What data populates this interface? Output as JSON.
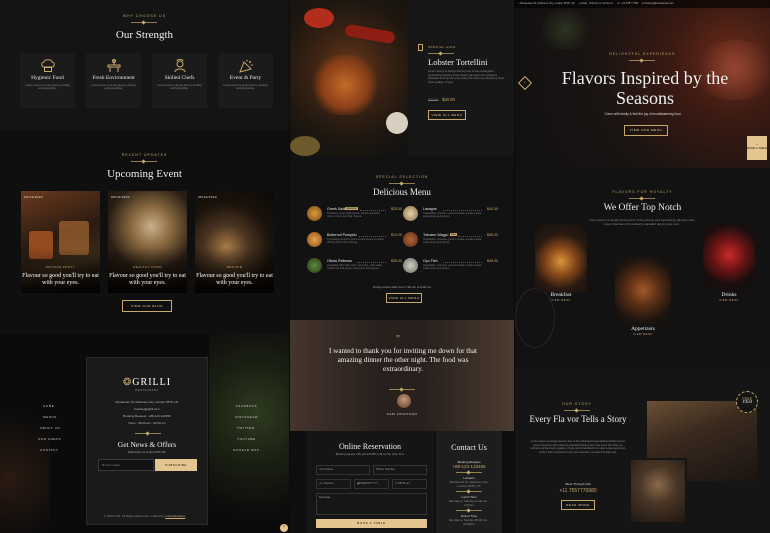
{
  "col1": {
    "strength": {
      "eyebrow": "WHY CHOOSE US",
      "title": "Our Strength",
      "cards": [
        {
          "icon": "chef-hat-icon",
          "title": "Hygienic Food",
          "desc": "Lorem Ipsum is simply dummy printing and typesetting."
        },
        {
          "icon": "restaurant-icon",
          "title": "Fresh Environment",
          "desc": "Lorem Ipsum is simply dummy printing and typesetting."
        },
        {
          "icon": "cook-icon",
          "title": "Skilled Chefs",
          "desc": "Lorem Ipsum is simply dummy printing and typesetting."
        },
        {
          "icon": "celebration-icon",
          "title": "Event & Party",
          "desc": "Lorem Ipsum is simply dummy printing and typesetting."
        }
      ]
    },
    "events": {
      "eyebrow": "RECENT UPDATES",
      "title": "Upcoming Event",
      "cards": [
        {
          "date": "09/12/2022",
          "tag": "PRIVATE PARTY",
          "caption": "Flavour so good you'll try to eat with your eyes."
        },
        {
          "date": "06/12/2022",
          "tag": "HEALTHY FOOD",
          "caption": "Flavour so good you'll try to eat with your eyes."
        },
        {
          "date": "06/12/2022",
          "tag": "RECIPIE",
          "caption": "Flavour so good you'll try to eat with your eyes."
        }
      ],
      "button": "VIEW OUR BLOG"
    },
    "footer": {
      "links_left": [
        "HOME",
        "MENUS",
        "ABOUT US",
        "OUR CHEFS",
        "CONTACT"
      ],
      "links_right": [
        "FACEBOOK",
        "INSTAGRAM",
        "TWITTER",
        "YOUTUBE",
        "GOOGLE MAP"
      ],
      "logo": "GRILLI",
      "logo_sub": "RESTAURANT",
      "address": "Restaurant St, Delicious City, London 9578, UK",
      "email": "booking@grilli.com",
      "booking": "Booking Request : +88-123-123456",
      "hours": "Open : 09:00 am - 01:00 pm",
      "newsletter_title": "Get News & Offers",
      "newsletter_sub": "Subscribe us & Get 25% Off.",
      "email_placeholder": "Your email",
      "subscribe": "SUBSCRIBE",
      "copyright": "© 2022 Grilli. All Rights Reserved | Crafted by",
      "credit": "codewithsadee"
    }
  },
  "col2": {
    "dish": {
      "eyebrow": "SPECIAL DISH",
      "title": "Lobster Tortellini",
      "desc": "Lorem Ipsum is simply dummy text of the printingand typesetting industry lorem Ipsum has been the industrys standard dummy text ever since the when an unknown printer took a galley of type.",
      "old_price": "$40.00",
      "price": "$20.00",
      "button": "VIEW ALL MENU"
    },
    "menu": {
      "eyebrow": "SPECIAL SELECTION",
      "title": "Delicious Menu",
      "items": [
        {
          "name": "Greek Salad",
          "badge": "Seasonal",
          "price": "$25.50",
          "desc": "Tomatoes, green bell pepper, sliced cucumber onion, olives, and feta cheese."
        },
        {
          "name": "Lasagne",
          "badge": "",
          "price": "$40.00",
          "desc": "Vegetables, cheeses, ground meats, tomato sauce, seasonings and spices"
        },
        {
          "name": "Butternut Pumpkin",
          "badge": "",
          "price": "$10.00",
          "desc": "Typesetting industry lorem Lorem Ipsum is simply dummy text of the printing."
        },
        {
          "name": "Tokusen Wagyu",
          "badge": "New",
          "price": "$39.00",
          "desc": "Vegetables, cheeses, ground meats, tomato sauce, seasonings and spices."
        },
        {
          "name": "Olivas Rellenas",
          "badge": "",
          "price": "$25.00",
          "desc": "Avocados with crab meat, red onion, crab salad stuffed red bell pepper and green bell pepper."
        },
        {
          "name": "Opu Fish",
          "badge": "",
          "price": "$49.00",
          "desc": "Vegetables, cheeses, ground meats, tomato sauce, seasonings and spices"
        }
      ],
      "hours_note": "During winter daily from 7:00 pm to 9:00 pm",
      "button": "VIEW ALL MENU"
    },
    "testimonial": {
      "quote": "I wanted to thank you for inviting me down for that amazing dinner the other night. The food was extraordinary.",
      "author": "SAM JONATHAN"
    },
    "reservation": {
      "title": "Online Reservation",
      "subtitle": "Booking request +88-123-123456 or fill out the order form",
      "fields": {
        "name": "Your Name",
        "phone": "Phone Number",
        "persons": "1 Person",
        "date": "MM/DD/YYYY",
        "time": "08:00 am",
        "message": "Message"
      },
      "button": "BOOK A TABLE",
      "contact_title": "Contact Us",
      "booking_label": "Booking Request",
      "booking_phone": "+88-123-123456",
      "location_label": "Location",
      "location": "Restaurant St, Delicious City, London 9578, UK",
      "lunch_label": "Lunch Time",
      "lunch": "Monday to Sunday 11.00 am - 2.30pm",
      "dinner_label": "Dinner Time",
      "dinner": "Monday to Sunday 05.00 pm - 10.00pm"
    }
  },
  "col3": {
    "topbar": {
      "address": "Restaurant St, Delicious City, London 9578, UK",
      "hours": "Daily : 8.00 am to 10.00 pm",
      "phone": "+11 3787 7780",
      "email": "booking@restaurant.com"
    },
    "hero": {
      "eyebrow": "DELIGHTFUL EXPERIENCE",
      "title": "Flavors Inspired by the Seasons",
      "sub": "Come with family & feel the joy of mouthwatering food",
      "button": "VIEW OUR MENU",
      "badge": "BOOK A TABLE"
    },
    "offer": {
      "eyebrow": "FLAVORS FOR ROYALTY",
      "title": "We Offer Top Notch",
      "desc": "Lorem Ipsum is simply dummy text of the printing and typesetting industry lorem Ipsum has been the industrys standard dummy text ever.",
      "cards": [
        {
          "name": "Breakfast",
          "link": "VIEW MENU"
        },
        {
          "name": "Appetizers",
          "link": "VIEW MENU"
        },
        {
          "name": "Drinks",
          "link": "VIEW MENU"
        }
      ]
    },
    "story": {
      "eyebrow": "OUR STORY",
      "title": "Every Fla vor Tells a Story",
      "desc": "Lorem Ipsum is simply dummy text of the printingand typesetting industry lorem Ipsum has been the industrys standard dummy text ever since the when an unknown printer took a galley of type and scrambled it to make a type specimen book It has survived not only five centuries, but also the leap into.",
      "book_label": "Book Through Call",
      "phone": "+11 7557770980",
      "button": "READ MORE",
      "since_label": "SINCE",
      "since_year": "1950"
    }
  },
  "colors": {
    "gold": "#c8a96a",
    "bg": "#121212",
    "card": "#1b1b1b"
  }
}
